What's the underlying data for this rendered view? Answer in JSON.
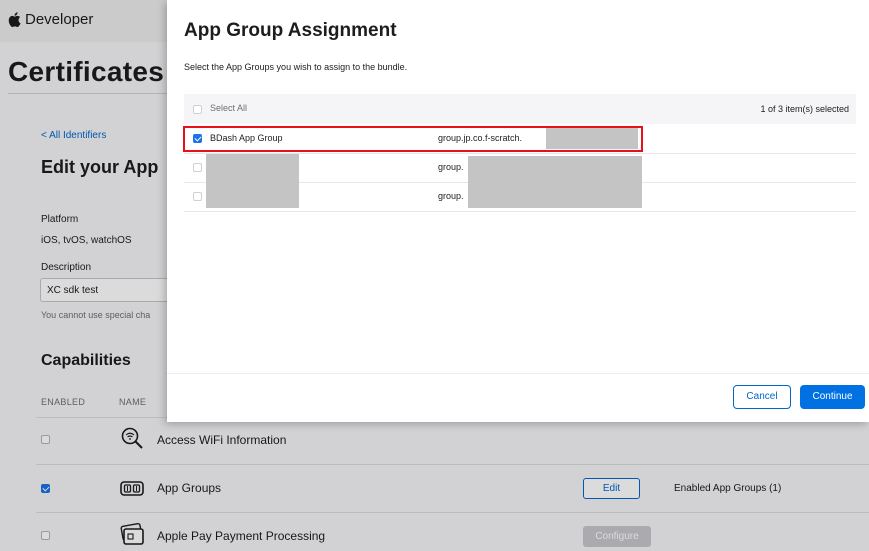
{
  "header": {
    "brand": "Developer"
  },
  "page": {
    "title": "Certificates",
    "breadcrumb": "< All Identifiers",
    "section_title": "Edit your App",
    "platform_label": "Platform",
    "platform_value": "iOS, tvOS, watchOS",
    "description_label": "Description",
    "description_value": "XC sdk test",
    "description_hint": "You cannot use special cha"
  },
  "capabilities": {
    "title": "Capabilities",
    "col_enabled": "ENABLED",
    "col_name": "NAME",
    "rows": [
      {
        "name": "Access WiFi Information",
        "enabled": false,
        "icon": "wifi-search-icon"
      },
      {
        "name": "App Groups",
        "enabled": true,
        "icon": "app-groups-icon",
        "button": "Edit",
        "status": "Enabled App Groups (1)"
      },
      {
        "name": "Apple Pay Payment Processing",
        "enabled": false,
        "icon": "wallet-card-icon",
        "button": "Configure"
      }
    ]
  },
  "modal": {
    "title": "App Group Assignment",
    "subtitle": "Select the App Groups you wish to assign to the bundle.",
    "select_all": "Select All",
    "count": "1 of 3 item(s) selected",
    "rows": [
      {
        "name": "BDash App Group",
        "identifier": "group.jp.co.f-scratch.",
        "checked": true
      },
      {
        "name": "",
        "identifier": "group.",
        "checked": false
      },
      {
        "name": "",
        "identifier": "group.",
        "checked": false
      }
    ],
    "cancel": "Cancel",
    "continue": "Continue"
  },
  "colors": {
    "accent": "#0071e3",
    "link": "#0066cc",
    "highlight": "#e8101a",
    "checkbox_on": "#1a73e8",
    "disabled_button": "#c8c8cc"
  }
}
